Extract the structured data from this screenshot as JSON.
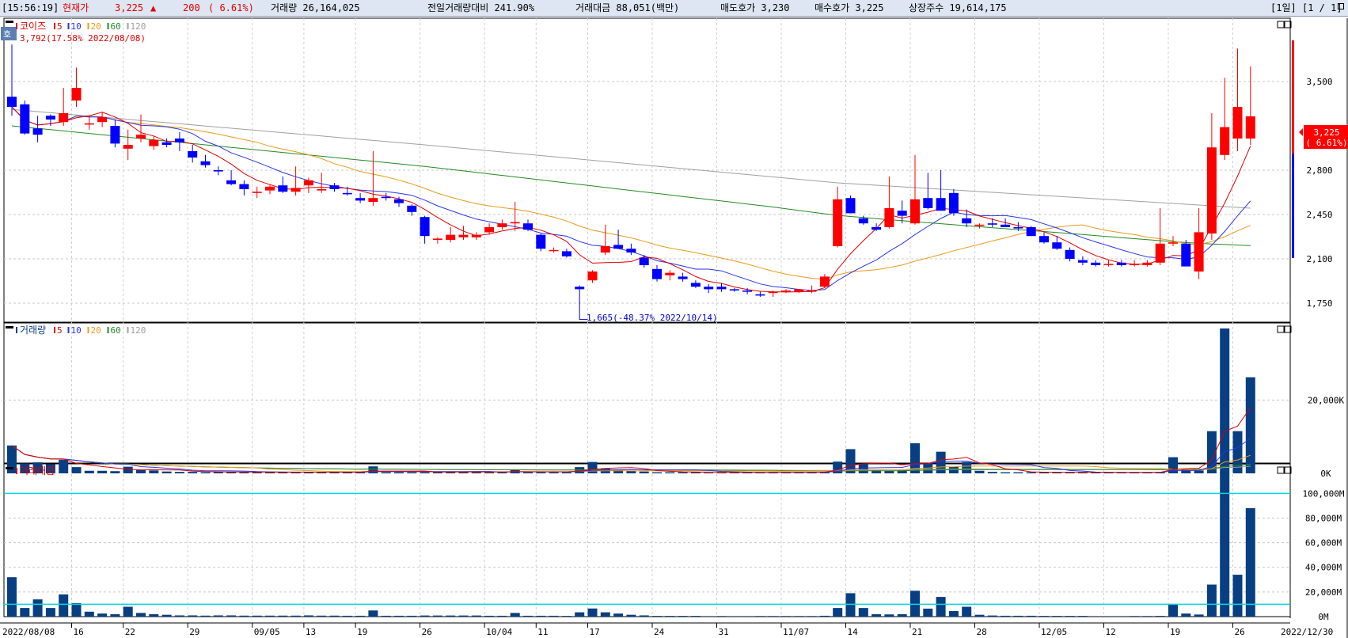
{
  "header": {
    "time": "[15:56:19]",
    "current_label": "현재가",
    "price": "3,225",
    "arrow": "▲",
    "change": "200",
    "change_pct": "( 6.61%)",
    "volume_text": "거래량 26,164,025",
    "prev_volume_ratio": "전일거래량대비 241.90%",
    "turnover": "거래대금 88,051(백만)",
    "ask": "매도호가 3,230",
    "bid": "매수호가 3,225",
    "listed_shares": "상장주수 19,614,175",
    "period": "[1일]",
    "page": "[1 / 1]"
  },
  "colors": {
    "up": "#ff0000",
    "down": "#0000ff",
    "ma5": "#e00000",
    "ma10": "#2a36e6",
    "ma20": "#ea9a1a",
    "ma60": "#238a23",
    "ma120": "#a0a0a0",
    "vol_bar": "#083e82",
    "cyan_line": "#00d6e6"
  },
  "price_panel": {
    "badge": "호",
    "title": "코이즈",
    "legend": [
      "5",
      "10",
      "20",
      "60",
      "120"
    ],
    "max_label": "3,792(17.58% 2022/08/08)",
    "min_label": "1,665(-48.37% 2022/10/14)",
    "price_tag": "3,225",
    "price_tag_pct": "( 6.61%)",
    "y_ticks": [
      3500,
      2800,
      2450,
      2100,
      1750
    ],
    "y_tick_labels": [
      "3,500",
      "2,800",
      "2,450",
      "2,100",
      "1,750"
    ],
    "ylim": [
      1600,
      4000
    ]
  },
  "volume_panel": {
    "title": "거래량",
    "legend": [
      "5",
      "10",
      "20",
      "60",
      "120"
    ],
    "y_tick_labels": [
      "20,000K",
      "0K"
    ],
    "y_ticks": [
      20000,
      0
    ],
    "ylim": [
      0,
      41000
    ]
  },
  "turnover_panel": {
    "title": "거래대금",
    "y_tick_labels": [
      "100,000M",
      "80,000M",
      "60,000M",
      "40,000M",
      "20,000M",
      "0M"
    ],
    "y_ticks": [
      100000,
      80000,
      60000,
      40000,
      20000,
      0
    ],
    "ylim": [
      0,
      124000
    ],
    "ref_lines": [
      100000,
      10000
    ]
  },
  "x_axis": {
    "labels": [
      "2022/08/08",
      "16",
      "22",
      "29",
      "09/05",
      "13",
      "19",
      "26",
      "10/04",
      "11",
      "17",
      "24",
      "31",
      "11/07",
      "14",
      "21",
      "28",
      "12/05",
      "12",
      "19",
      "26",
      "2022/12/30"
    ],
    "label_positions": [
      0,
      5,
      9,
      14,
      19,
      23,
      27,
      32,
      37,
      41,
      45,
      50,
      55,
      60,
      65,
      70,
      75,
      80,
      85,
      90,
      95,
      100
    ]
  },
  "chart_data": {
    "type": "candlestick",
    "series": [
      {
        "name": "코이즈",
        "ohlc": [
          [
            3380,
            3792,
            3230,
            3300
          ],
          [
            3320,
            3350,
            3080,
            3090
          ],
          [
            3130,
            3230,
            3020,
            3080
          ],
          [
            3230,
            3240,
            3150,
            3200
          ],
          [
            3180,
            3450,
            3150,
            3250
          ],
          [
            3350,
            3610,
            3300,
            3450
          ],
          [
            3160,
            3230,
            3120,
            3170
          ],
          [
            3180,
            3260,
            3140,
            3220
          ],
          [
            3150,
            3200,
            2980,
            3010
          ],
          [
            2970,
            3120,
            2880,
            3000
          ],
          [
            3050,
            3240,
            3020,
            3080
          ],
          [
            2990,
            3070,
            2960,
            3040
          ],
          [
            3020,
            3050,
            2980,
            3000
          ],
          [
            3050,
            3100,
            2950,
            3020
          ],
          [
            2950,
            3000,
            2860,
            2900
          ],
          [
            2870,
            2920,
            2820,
            2840
          ],
          [
            2800,
            2830,
            2760,
            2790
          ],
          [
            2720,
            2800,
            2680,
            2690
          ],
          [
            2690,
            2720,
            2600,
            2650
          ],
          [
            2620,
            2670,
            2580,
            2630
          ],
          [
            2640,
            2690,
            2610,
            2670
          ],
          [
            2680,
            2750,
            2620,
            2630
          ],
          [
            2630,
            2830,
            2600,
            2660
          ],
          [
            2680,
            2740,
            2620,
            2720
          ],
          [
            2640,
            2780,
            2620,
            2650
          ],
          [
            2680,
            2700,
            2630,
            2650
          ],
          [
            2620,
            2670,
            2600,
            2610
          ],
          [
            2580,
            2620,
            2540,
            2560
          ],
          [
            2550,
            2950,
            2520,
            2580
          ],
          [
            2590,
            2620,
            2560,
            2580
          ],
          [
            2570,
            2590,
            2510,
            2540
          ],
          [
            2520,
            2530,
            2440,
            2470
          ],
          [
            2430,
            2440,
            2220,
            2280
          ],
          [
            2250,
            2270,
            2220,
            2260
          ],
          [
            2250,
            2350,
            2230,
            2290
          ],
          [
            2270,
            2360,
            2250,
            2290
          ],
          [
            2270,
            2310,
            2250,
            2290
          ],
          [
            2310,
            2380,
            2290,
            2350
          ],
          [
            2350,
            2410,
            2330,
            2380
          ],
          [
            2380,
            2550,
            2320,
            2390
          ],
          [
            2380,
            2410,
            2320,
            2330
          ],
          [
            2290,
            2300,
            2160,
            2180
          ],
          [
            2170,
            2190,
            2150,
            2170
          ],
          [
            2160,
            2180,
            2110,
            2120
          ],
          [
            1880,
            1890,
            1665,
            1860
          ],
          [
            1930,
            2010,
            1910,
            2000
          ],
          [
            2150,
            2370,
            2130,
            2200
          ],
          [
            2210,
            2330,
            2190,
            2180
          ],
          [
            2180,
            2220,
            2130,
            2150
          ],
          [
            2110,
            2130,
            2030,
            2050
          ],
          [
            2020,
            2050,
            1920,
            1940
          ],
          [
            1970,
            2010,
            1930,
            1990
          ],
          [
            1960,
            1990,
            1920,
            1940
          ],
          [
            1910,
            1930,
            1870,
            1880
          ],
          [
            1880,
            1900,
            1830,
            1860
          ],
          [
            1880,
            1910,
            1840,
            1860
          ],
          [
            1860,
            1870,
            1840,
            1850
          ],
          [
            1850,
            1870,
            1820,
            1840
          ],
          [
            1820,
            1840,
            1800,
            1810
          ],
          [
            1830,
            1850,
            1800,
            1840
          ],
          [
            1840,
            1860,
            1830,
            1850
          ],
          [
            1840,
            1860,
            1830,
            1860
          ],
          [
            1840,
            1890,
            1830,
            1850
          ],
          [
            1880,
            1980,
            1870,
            1960
          ],
          [
            2200,
            2670,
            2190,
            2570
          ],
          [
            2580,
            2600,
            2460,
            2460
          ],
          [
            2420,
            2440,
            2370,
            2380
          ],
          [
            2350,
            2380,
            2320,
            2330
          ],
          [
            2350,
            2750,
            2340,
            2500
          ],
          [
            2480,
            2560,
            2380,
            2440
          ],
          [
            2380,
            2920,
            2370,
            2570
          ],
          [
            2580,
            2780,
            2490,
            2500
          ],
          [
            2580,
            2800,
            2520,
            2480
          ],
          [
            2620,
            2650,
            2440,
            2460
          ],
          [
            2420,
            2490,
            2350,
            2380
          ],
          [
            2370,
            2380,
            2340,
            2370
          ],
          [
            2380,
            2420,
            2350,
            2370
          ],
          [
            2370,
            2420,
            2350,
            2350
          ],
          [
            2350,
            2390,
            2320,
            2340
          ],
          [
            2350,
            2360,
            2280,
            2280
          ],
          [
            2280,
            2310,
            2220,
            2230
          ],
          [
            2230,
            2280,
            2170,
            2180
          ],
          [
            2170,
            2190,
            2080,
            2100
          ],
          [
            2090,
            2120,
            2050,
            2070
          ],
          [
            2070,
            2090,
            2040,
            2050
          ],
          [
            2060,
            2090,
            2040,
            2060
          ],
          [
            2070,
            2090,
            2040,
            2050
          ],
          [
            2060,
            2090,
            2040,
            2060
          ],
          [
            2050,
            2090,
            2040,
            2070
          ],
          [
            2070,
            2500,
            2050,
            2220
          ],
          [
            2220,
            2280,
            2200,
            2230
          ],
          [
            2220,
            2250,
            2170,
            2040
          ],
          [
            2000,
            2500,
            1940,
            2310
          ],
          [
            2300,
            3250,
            2250,
            2980
          ],
          [
            2920,
            3530,
            2880,
            3140
          ],
          [
            3050,
            3760,
            2950,
            3300
          ],
          [
            3050,
            3620,
            3000,
            3225
          ]
        ]
      }
    ],
    "volume_k": [
      7600,
      2700,
      3000,
      2500,
      3700,
      1700,
      700,
      700,
      600,
      1800,
      1000,
      800,
      500,
      400,
      400,
      300,
      400,
      400,
      300,
      300,
      300,
      300,
      300,
      400,
      300,
      300,
      300,
      300,
      1900,
      300,
      300,
      300,
      400,
      400,
      400,
      400,
      400,
      300,
      300,
      1000,
      300,
      300,
      300,
      300,
      1700,
      3100,
      1300,
      1000,
      700,
      500,
      300,
      300,
      300,
      300,
      200,
      300,
      200,
      200,
      300,
      300,
      300,
      300,
      300,
      400,
      3200,
      6600,
      2600,
      900,
      700,
      900,
      8200,
      2700,
      5900,
      1800,
      3100,
      700,
      400,
      300,
      300,
      300,
      300,
      300,
      300,
      300,
      200,
      200,
      200,
      300,
      300,
      300,
      4400,
      1100,
      800,
      11500,
      39500,
      11500,
      26200
    ],
    "turnover_m": [
      32000,
      7000,
      14000,
      7000,
      18000,
      11000,
      4000,
      2500,
      2000,
      8000,
      3000,
      2000,
      1500,
      1000,
      1000,
      800,
      1000,
      1000,
      800,
      800,
      800,
      800,
      800,
      1000,
      800,
      800,
      700,
      700,
      5000,
      700,
      700,
      700,
      900,
      900,
      900,
      900,
      900,
      700,
      700,
      3000,
      700,
      700,
      700,
      600,
      3500,
      6600,
      3500,
      2500,
      1500,
      1000,
      600,
      600,
      600,
      600,
      400,
      500,
      400,
      400,
      500,
      500,
      500,
      500,
      500,
      700,
      7000,
      19000,
      7000,
      2000,
      1800,
      2000,
      21000,
      6500,
      16000,
      4500,
      8000,
      1500,
      900,
      700,
      700,
      700,
      600,
      600,
      600,
      600,
      400,
      400,
      400,
      500,
      500,
      600,
      10000,
      2500,
      1700,
      26000,
      117000,
      34000,
      88051
    ]
  }
}
